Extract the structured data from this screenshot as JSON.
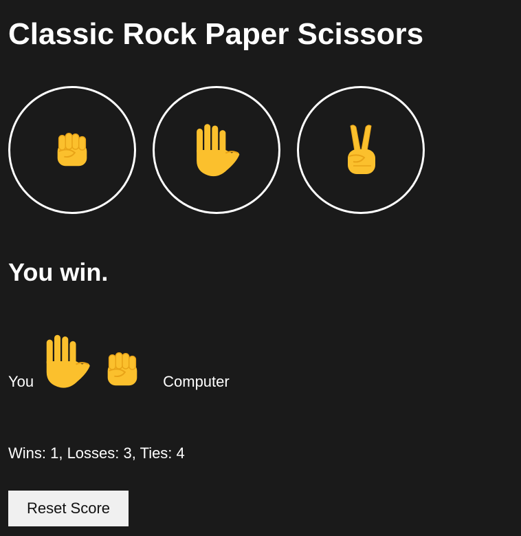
{
  "title": "Classic Rock Paper Scissors",
  "choices": [
    {
      "icon": "rock-fist-icon"
    },
    {
      "icon": "paper-hand-icon"
    },
    {
      "icon": "scissors-victory-hand-icon"
    }
  ],
  "result": "You win.",
  "matchup": {
    "player_label": "You",
    "player_choice_icon": "paper-hand-icon",
    "computer_choice_icon": "rock-fist-icon",
    "computer_label": "Computer"
  },
  "score_text": "Wins: 1, Losses: 3, Ties: 4",
  "reset_label": "Reset Score",
  "colors": {
    "background": "#1a1a1a",
    "text": "#ffffff",
    "emoji_fill": "#fbc02d",
    "emoji_shade": "#e8a317",
    "button_bg": "#f0f0f0"
  }
}
